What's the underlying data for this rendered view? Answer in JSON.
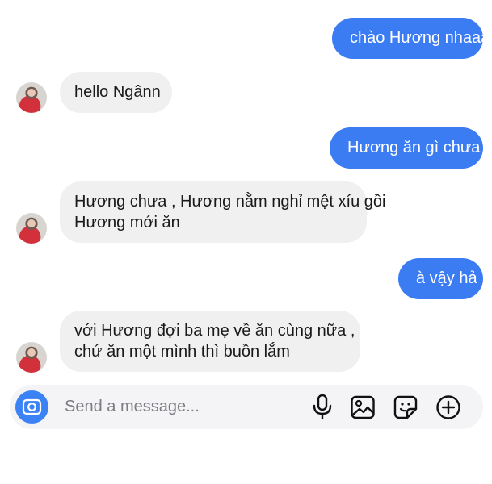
{
  "conversation": {
    "messages": [
      {
        "direction": "outgoing",
        "text": "chào Hương nhaaa"
      },
      {
        "direction": "incoming",
        "text": "hello Ngânn"
      },
      {
        "direction": "outgoing",
        "text": "Hương ăn gì chưa"
      },
      {
        "direction": "incoming",
        "lines": [
          "Hương chưa , Hương nằm nghỉ mệt xíu gồi",
          "Hương mới ăn"
        ]
      },
      {
        "direction": "outgoing",
        "text": "à vậy hả"
      },
      {
        "direction": "incoming",
        "lines": [
          "với Hương đợi ba mẹ về ăn cùng nữa ,",
          "chứ ăn một mình thì buồn lắm"
        ]
      }
    ]
  },
  "composer": {
    "placeholder": "Send a message...",
    "value": "",
    "icons": [
      "camera-icon",
      "microphone-icon",
      "gallery-icon",
      "sticker-icon",
      "add-icon"
    ]
  },
  "colors": {
    "outgoing_bubble": "#3b7cf3",
    "incoming_bubble": "#f0f0f1",
    "camera_button": "#3b82f6"
  }
}
